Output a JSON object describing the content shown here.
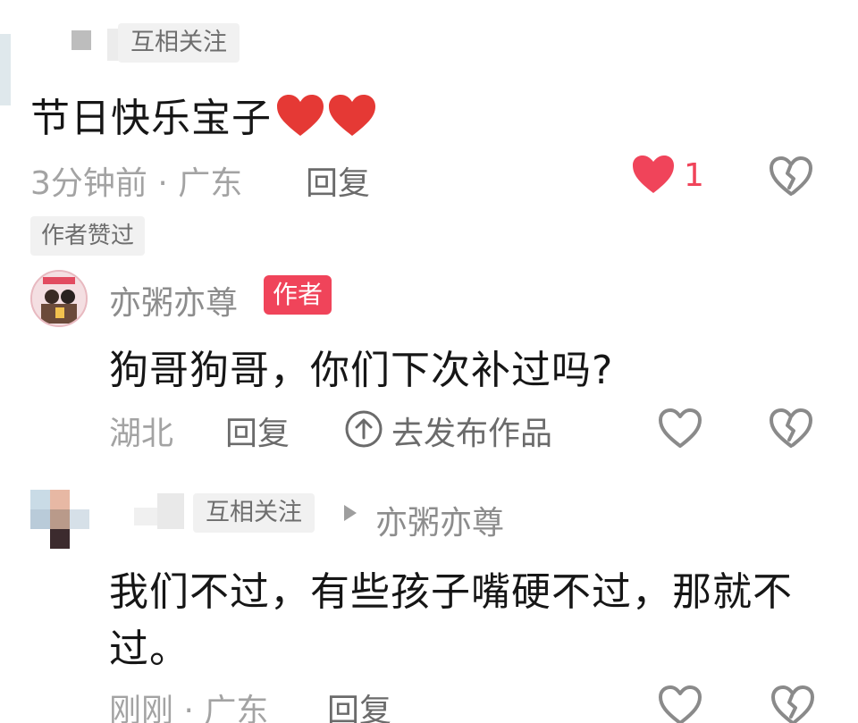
{
  "comment1": {
    "follow_tag": "互相关注",
    "text": "节日快乐宝子",
    "emoji": "❤️❤️",
    "meta": "3分钟前 · 广东",
    "reply_label": "回复",
    "like_count": "1",
    "liked_by_author_tag": "作者赞过",
    "like_icon": "heart-filled-icon",
    "dislike_icon": "broken-heart-icon"
  },
  "reply1": {
    "username": "亦粥亦尊",
    "author_badge": "作者",
    "text": "狗哥狗哥，你们下次补过吗?",
    "location": "湖北",
    "reply_label": "回复",
    "publish_label": "去发布作品",
    "publish_icon": "arrow-up-circle-icon",
    "like_icon": "heart-outline-icon",
    "dislike_icon": "broken-heart-icon"
  },
  "reply2": {
    "follow_tag": "互相关注",
    "reply_to": "亦粥亦尊",
    "text_line1": "我们不过，有些孩子嘴硬不过，那就不",
    "text_line2": "过。",
    "meta": "刚刚 · 广东",
    "reply_label": "回复",
    "like_icon": "heart-outline-icon",
    "dislike_icon": "broken-heart-icon"
  },
  "colors": {
    "accent_red": "#f0445a",
    "meta_gray": "#a3a3a3",
    "text_dark": "#161616",
    "tag_bg": "#f1f1f1"
  }
}
